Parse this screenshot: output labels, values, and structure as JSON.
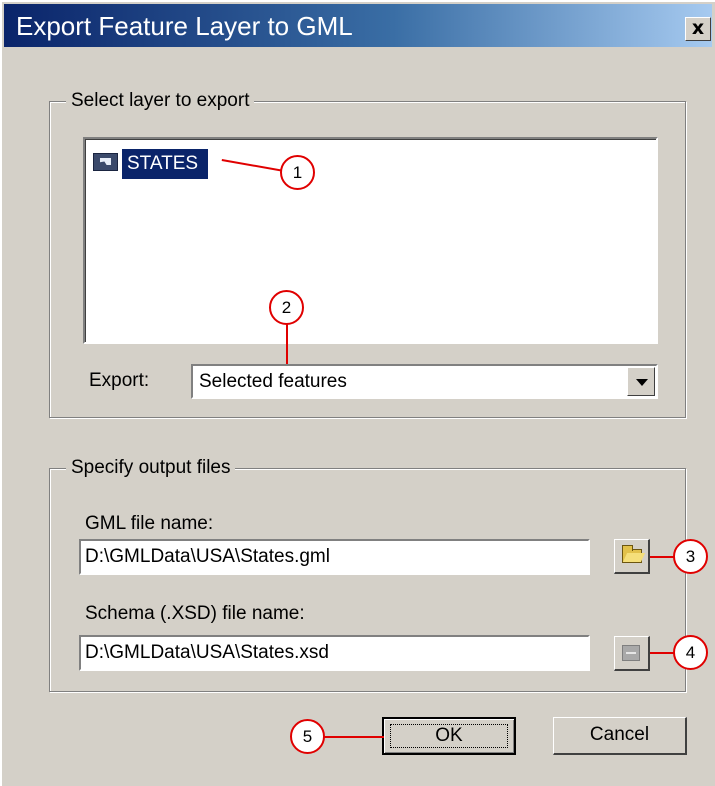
{
  "window": {
    "title": "Export Feature Layer to GML",
    "close_glyph": "x",
    "close_icon": "close-icon"
  },
  "layer_group": {
    "legend": "Select layer to export",
    "layers": [
      {
        "name": "STATES",
        "icon": "feature-layer-icon",
        "selected": true
      }
    ],
    "export_label": "Export:",
    "export_value": "Selected features"
  },
  "output_group": {
    "legend": "Specify output files",
    "gml_label": "GML file name:",
    "gml_value": "D:\\GMLData\\USA\\States.gml",
    "gml_browse_icon": "open-folder-icon",
    "schema_label": "Schema (.XSD) file name:",
    "schema_value": "D:\\GMLData\\USA\\States.xsd",
    "schema_browse_icon": "schema-file-icon"
  },
  "buttons": {
    "ok": "OK",
    "cancel": "Cancel"
  },
  "callouts": [
    "1",
    "2",
    "3",
    "4",
    "5"
  ],
  "colors": {
    "dialog_bg": "#d4d0c8",
    "selection": "#0a246a",
    "callout": "#e00000"
  }
}
